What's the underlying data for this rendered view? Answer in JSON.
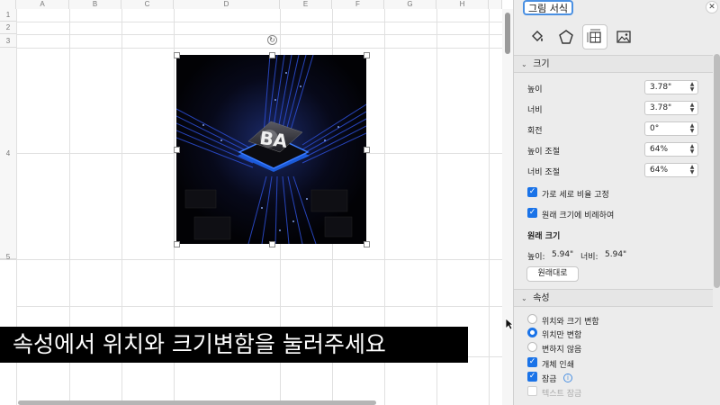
{
  "sheet": {
    "columns": [
      "A",
      "B",
      "C",
      "D",
      "E",
      "F",
      "G",
      "H"
    ],
    "rows": [
      "1",
      "2",
      "3",
      "4",
      "5"
    ]
  },
  "caption": "속성에서 위치와 크기변함을 눌러주세요",
  "picture": {
    "chip_text": "BA"
  },
  "pane": {
    "title": "그림 서식",
    "close": "✕",
    "size_section": {
      "heading": "크기",
      "height_label": "높이",
      "height_value": "3.78\"",
      "width_label": "너비",
      "width_value": "3.78\"",
      "rotation_label": "회전",
      "rotation_value": "0°",
      "scale_height_label": "높이 조절",
      "scale_height_value": "64%",
      "scale_width_label": "너비 조절",
      "scale_width_value": "64%",
      "lock_aspect_label": "가로 세로 비율 고정",
      "relative_original_label": "원래 크기에 비례하여",
      "original_size_heading": "원래 크기",
      "orig_height_label": "높이:",
      "orig_height_value": "5.94\"",
      "orig_width_label": "너비:",
      "orig_width_value": "5.94\"",
      "reset_button": "원래대로"
    },
    "properties_section": {
      "heading": "속성",
      "option1": "위치와 크기 변함",
      "option2": "위치만 변함",
      "option3": "변하지 않음",
      "print_label": "개체 인쇄",
      "locked_label": "잠금",
      "lock_text_label": "텍스트 잠금"
    }
  }
}
